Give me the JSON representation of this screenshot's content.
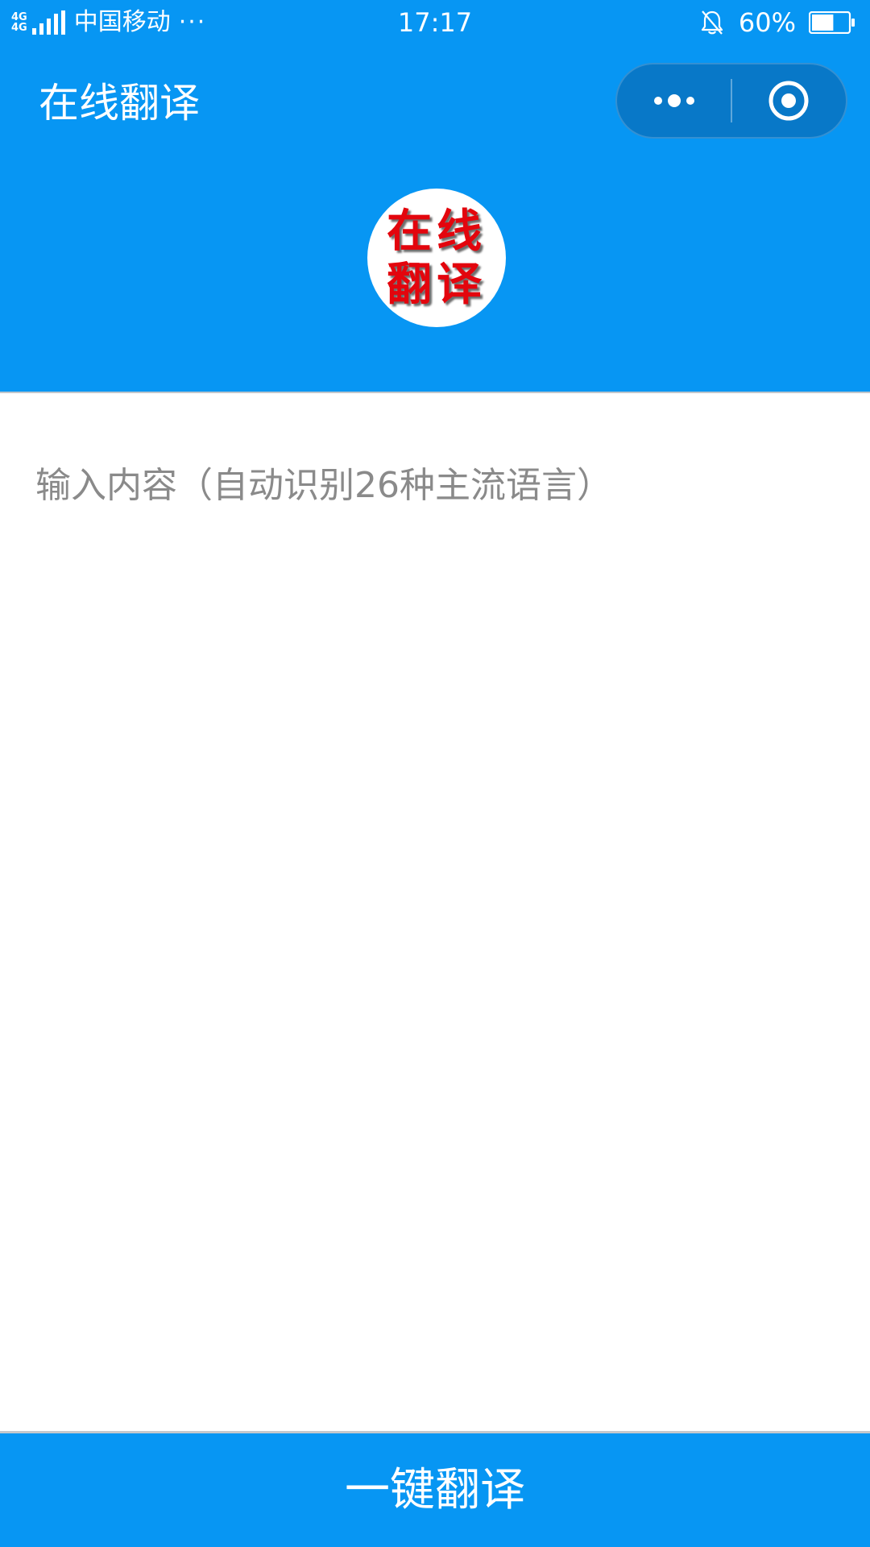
{
  "status_bar": {
    "network_1": "4G",
    "network_2": "4G",
    "carrier": "中国移动",
    "more": "···",
    "time": "17:17",
    "battery_level": "60%",
    "battery_fraction": 0.6,
    "icons": [
      "signal-icon",
      "bell-mute-icon",
      "battery-icon"
    ]
  },
  "nav": {
    "title": "在线翻译",
    "capsule_icons": [
      "more-dots-icon",
      "close-circle-icon"
    ]
  },
  "logo": {
    "line1": "在线",
    "line2": "翻译"
  },
  "input": {
    "placeholder": "输入内容（自动识别26种主流语言）",
    "value": ""
  },
  "action": {
    "translate_label": "一键翻译"
  },
  "colors": {
    "primary": "#0796f3",
    "capsule": "#0878c8",
    "logo_text": "#e3050d",
    "placeholder": "#8a8a8a"
  }
}
